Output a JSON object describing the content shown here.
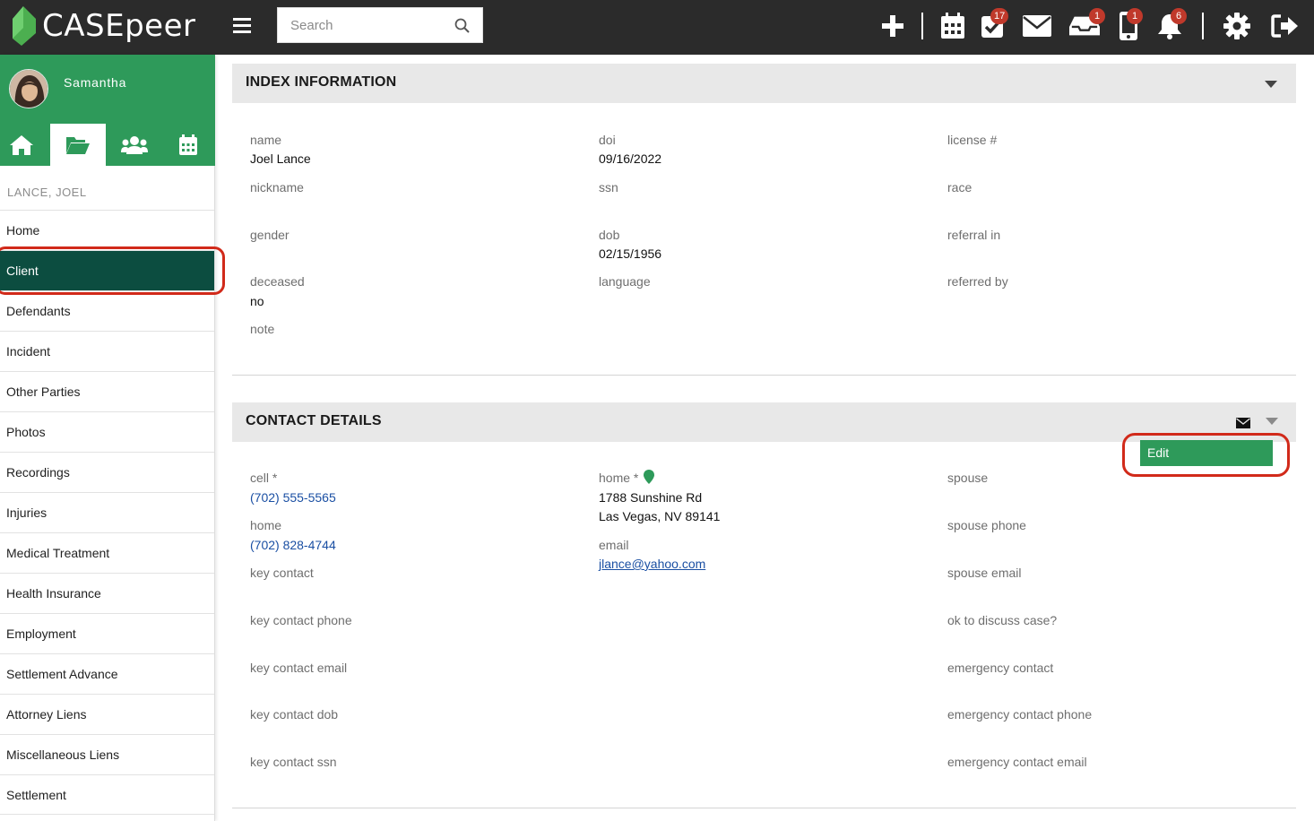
{
  "app": {
    "logo_text": "CASEpeer",
    "search_placeholder": "Search",
    "badges": {
      "tasks": "17",
      "inbox": "1",
      "phone": "1",
      "notifications": "6"
    },
    "icons": [
      "plus-icon",
      "calendar-icon",
      "tasks-check-icon",
      "mail-icon",
      "inbox-tray-icon",
      "mobile-phone-icon",
      "bell-icon",
      "gear-icon",
      "sign-out-icon"
    ]
  },
  "sidebar": {
    "user_name": "Samantha",
    "case_name": "LANCE, JOEL",
    "items": [
      {
        "label": "Home"
      },
      {
        "label": "Client"
      },
      {
        "label": "Defendants"
      },
      {
        "label": "Incident"
      },
      {
        "label": "Other Parties"
      },
      {
        "label": "Photos"
      },
      {
        "label": "Recordings"
      },
      {
        "label": "Injuries"
      },
      {
        "label": "Medical Treatment"
      },
      {
        "label": "Health Insurance"
      },
      {
        "label": "Employment"
      },
      {
        "label": "Settlement Advance"
      },
      {
        "label": "Attorney Liens"
      },
      {
        "label": "Miscellaneous Liens"
      },
      {
        "label": "Settlement"
      }
    ],
    "active_item": "Client"
  },
  "index_info": {
    "title": "INDEX INFORMATION",
    "name_label": "name",
    "name_value": "Joel Lance",
    "doi_label": "doi",
    "doi_value": "09/16/2022",
    "license_label": "license #",
    "nickname_label": "nickname",
    "ssn_label": "ssn",
    "race_label": "race",
    "gender_label": "gender",
    "dob_label": "dob",
    "dob_value": "02/15/1956",
    "referral_in_label": "referral in",
    "deceased_label": "deceased",
    "deceased_value": "no",
    "language_label": "language",
    "referred_by_label": "referred by",
    "note_label": "note"
  },
  "contact": {
    "title": "CONTACT DETAILS",
    "edit_label": "Edit",
    "cell_label": "cell *",
    "cell_value": "(702) 555-5565",
    "home_phone_label": "home",
    "home_phone_value": "(702) 828-4744",
    "key_contact_label": "key contact",
    "key_contact_phone_label": "key contact phone",
    "key_contact_email_label": "key contact email",
    "key_contact_dob_label": "key contact dob",
    "key_contact_ssn_label": "key contact ssn",
    "home_addr_label": "home *",
    "address_line1": "1788 Sunshine Rd",
    "address_line2": "Las Vegas, NV 89141",
    "email_label": "email",
    "email_value": "jlance@yahoo.com",
    "spouse_label": "spouse",
    "spouse_phone_label": "spouse phone",
    "spouse_email_label": "spouse email",
    "ok_discuss_label": "ok to discuss case?",
    "emergency_contact_label": "emergency contact",
    "emergency_phone_label": "emergency contact phone",
    "emergency_email_label": "emergency contact email"
  },
  "colors": {
    "brand_green": "#2e9a5a",
    "active_nav": "#0c4d40",
    "topbar": "#2b2b2b",
    "badge": "#c0392b",
    "highlight_ring": "#d12a1a",
    "link": "#1a4fa3"
  }
}
